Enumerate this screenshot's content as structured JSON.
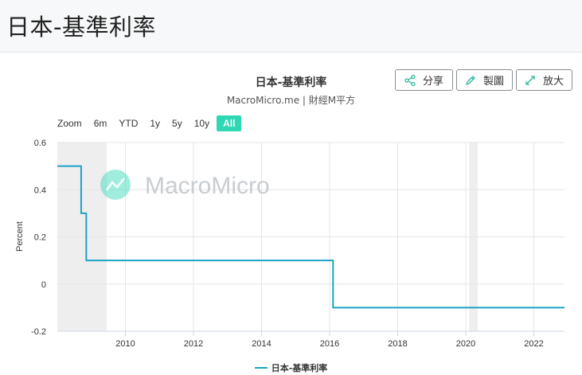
{
  "page": {
    "title": "日本-基準利率"
  },
  "toolbar": {
    "share_label": "分享",
    "draw_label": "製圖",
    "zoom_label": "放大"
  },
  "zoom": {
    "label": "Zoom",
    "options": [
      "6m",
      "YTD",
      "1y",
      "5y",
      "10y",
      "All"
    ],
    "active": "All"
  },
  "watermark": {
    "text": "MacroMicro"
  },
  "colors": {
    "series": "#1ba3c6",
    "accent": "#2fd7b3",
    "recession": "#eeeeee"
  },
  "chart_data": {
    "type": "line",
    "title": "日本-基準利率",
    "subtitle": "MacroMicro.me | 財經M平方",
    "xlabel": "",
    "ylabel": "Percent",
    "xlim": [
      2008.0,
      2022.9
    ],
    "ylim": [
      -0.2,
      0.6
    ],
    "y_ticks": [
      -0.2,
      0,
      0.2,
      0.4,
      0.6
    ],
    "y_tick_labels": [
      "-0.2",
      "0",
      "0.2",
      "0.4",
      "0.6"
    ],
    "x_ticks": [
      2010,
      2012,
      2014,
      2016,
      2018,
      2020,
      2022
    ],
    "x_tick_labels": [
      "2010",
      "2012",
      "2014",
      "2016",
      "2018",
      "2020",
      "2022"
    ],
    "grid": true,
    "legend_position": "bottom-center",
    "shaded_periods": [
      [
        2008.0,
        2009.45
      ],
      [
        2020.1,
        2020.35
      ]
    ],
    "series": [
      {
        "name": "日本-基準利率",
        "step": true,
        "x": [
          2008.0,
          2008.6,
          2008.7,
          2008.85,
          2015.95,
          2016.1,
          2022.9
        ],
        "y": [
          0.5,
          0.5,
          0.3,
          0.1,
          0.1,
          -0.1,
          -0.1
        ]
      }
    ]
  }
}
